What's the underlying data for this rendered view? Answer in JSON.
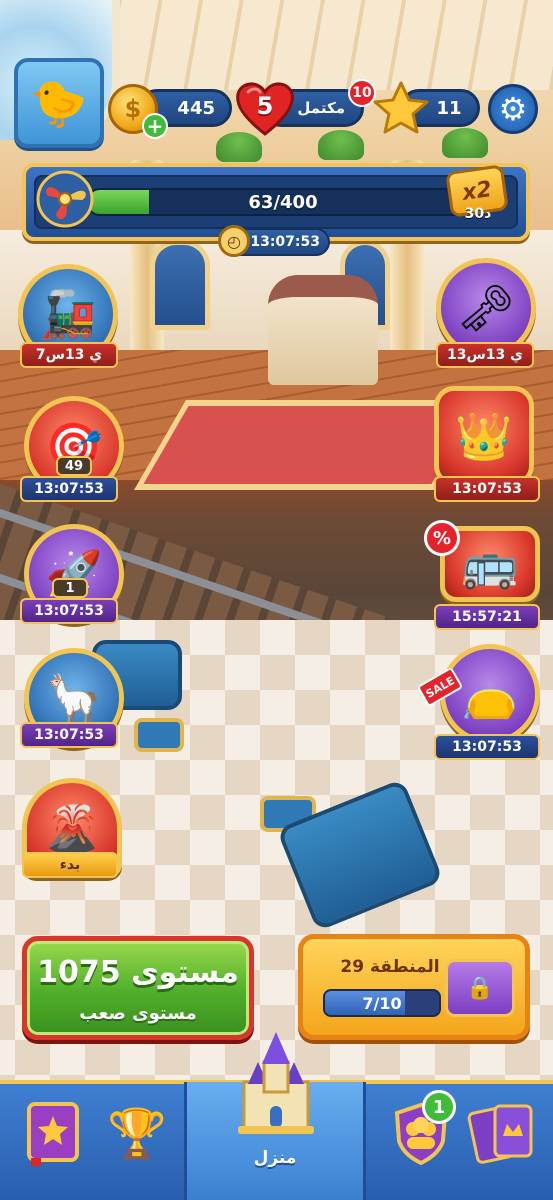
{
  "hud": {
    "coins": "445",
    "coin_plus": "+",
    "lives": "5",
    "lives_status": "مكتمل",
    "lives_badge": "10",
    "stars": "11"
  },
  "progress": {
    "text": "63/400",
    "fraction": 0.1575,
    "multiplier": "x2",
    "multiplier_time": "30د",
    "timer": "13:07:53"
  },
  "events": {
    "train_time": "7ي 13س",
    "key_time": "13ي 13س",
    "target_count": "49",
    "target_time": "13:07:53",
    "crown_time": "13:07:53",
    "rocket_count": "1",
    "rocket_time": "13:07:53",
    "bus_badge": "%",
    "bus_time": "15:57:21",
    "pinata_time": "13:07:53",
    "bag_sale": "SALE",
    "bag_time": "13:07:53",
    "volcano_label": "بدء"
  },
  "level_button": {
    "title": "مستوى 1075",
    "subtitle": "مستوى صعب"
  },
  "area_button": {
    "title": "المنطقة 29",
    "progress_text": "7/10",
    "fraction": 0.7
  },
  "nav": {
    "home_label": "منزل",
    "team_badge": "1"
  }
}
